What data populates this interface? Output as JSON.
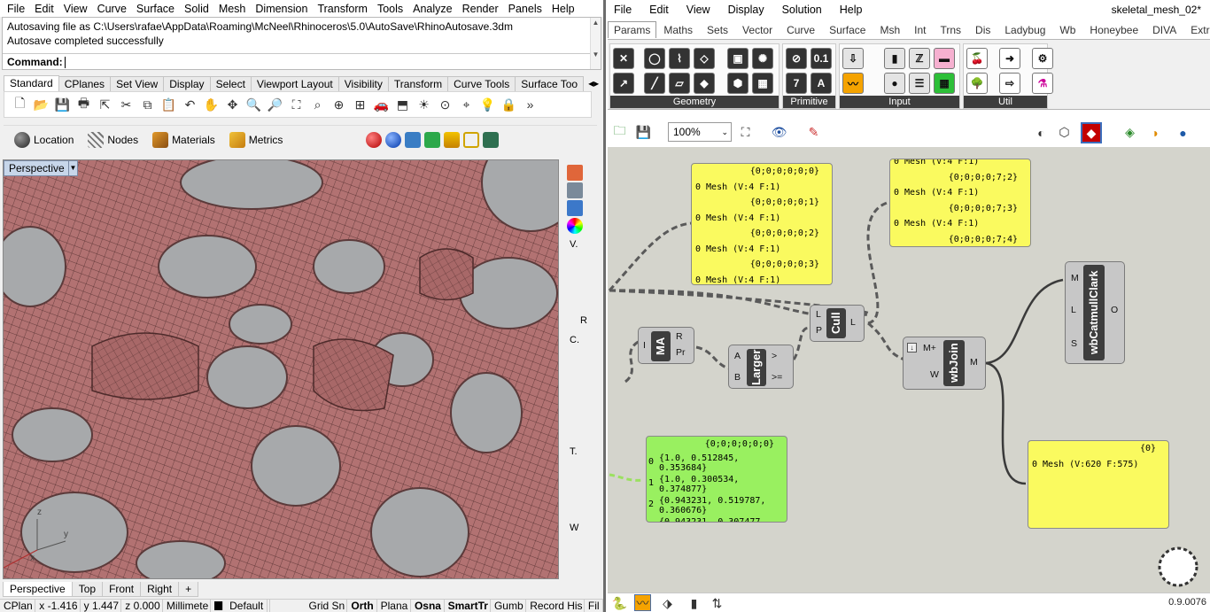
{
  "rhino": {
    "menu": [
      "File",
      "Edit",
      "View",
      "Curve",
      "Surface",
      "Solid",
      "Mesh",
      "Dimension",
      "Transform",
      "Tools",
      "Analyze",
      "Render",
      "Panels",
      "Help"
    ],
    "command_history": [
      "Autosaving file as C:\\Users\\rafae\\AppData\\Roaming\\McNeel\\Rhinoceros\\5.0\\AutoSave\\RhinoAutosave.3dm",
      "Autosave completed successfully"
    ],
    "command_label": "Command:",
    "toolbar_tabs": [
      "Standard",
      "CPlanes",
      "Set View",
      "Display",
      "Select",
      "Viewport Layout",
      "Visibility",
      "Transform",
      "Curve Tools",
      "Surface Too"
    ],
    "active_tab": "Standard",
    "toolbar2": [
      "Location",
      "Nodes",
      "Materials",
      "Metrics"
    ],
    "viewport_title": "Perspective",
    "viewport_tabs": [
      "Perspective",
      "Top",
      "Front",
      "Right"
    ],
    "side_panel_labels": [
      "V.",
      "R",
      "C.",
      "T.",
      "W"
    ],
    "status": {
      "cplane": "CPlan",
      "x": "x -1.416",
      "y": "y 1.447",
      "z": "z 0.000",
      "units": "Millimete",
      "layer": "Default",
      "grid_snap": "Grid Sn",
      "ortho": "Orth",
      "planar": "Plana",
      "osnap": "Osna",
      "smarttrack": "SmartTr",
      "gumball": "Gumb",
      "record_history": "Record His",
      "filter": "Fil"
    },
    "mesh_color": "#b06e6e",
    "viewport_bg": "#a7a9ab"
  },
  "gh": {
    "menu": [
      "File",
      "Edit",
      "View",
      "Display",
      "Solution",
      "Help"
    ],
    "title": "skeletal_mesh_02*",
    "tabs": [
      "Params",
      "Maths",
      "Sets",
      "Vector",
      "Curve",
      "Surface",
      "Msh",
      "Int",
      "Trns",
      "Dis",
      "Ladybug",
      "Wb",
      "Honeybee",
      "DIVA",
      "Extra"
    ],
    "active_tab": "Params",
    "ribbon_groups": [
      "Geometry",
      "Primitive",
      "Input",
      "Util"
    ],
    "zoom": "100%",
    "version": "0.9.0076",
    "panel_top": {
      "rows": [
        {
          "k": "hdr",
          "t": "{0;0;0;0;0;0}"
        },
        {
          "k": "item",
          "t": "0 Mesh (V:4  F:1)"
        },
        {
          "k": "hdr",
          "t": "{0;0;0;0;0;1}"
        },
        {
          "k": "item",
          "t": "0 Mesh (V:4  F:1)"
        },
        {
          "k": "hdr",
          "t": "{0;0;0;0;0;2}"
        },
        {
          "k": "item",
          "t": "0 Mesh (V:4  F:1)"
        },
        {
          "k": "hdr",
          "t": "{0;0;0;0;0;3}"
        },
        {
          "k": "item",
          "t": "0 Mesh (V:4  F:1)"
        }
      ]
    },
    "panel_right": {
      "rows": [
        {
          "k": "item",
          "t": "0 Mesh (V:4  F:1)"
        },
        {
          "k": "hdr",
          "t": "{0;0;0;0;7;2}"
        },
        {
          "k": "item",
          "t": "0 Mesh (V:4  F:1)"
        },
        {
          "k": "hdr",
          "t": "{0;0;0;0;7;3}"
        },
        {
          "k": "item",
          "t": "0 Mesh (V:4  F:1)"
        },
        {
          "k": "hdr",
          "t": "{0;0;0;0;7;4}"
        }
      ]
    },
    "panel_green": {
      "header": "{0;0;0;0;0;0}",
      "items": [
        {
          "i": "0",
          "t": "{1.0, 0.512845, 0.353684}"
        },
        {
          "i": "1",
          "t": "{1.0, 0.300534, 0.374877}"
        },
        {
          "i": "2",
          "t": "{0.943231, 0.519787, 0.360676}"
        },
        {
          "i": "",
          "t": "{0.943231, 0.307477"
        }
      ]
    },
    "panel_result": {
      "header": "{0}",
      "item": "0 Mesh (V:620  F:575)"
    },
    "comp_ma": {
      "name": "MA",
      "in": "I",
      "out1": "R",
      "out2": "Pr"
    },
    "comp_larger": {
      "name": "Larger",
      "in1": "A",
      "in2": "B",
      "out1": ">",
      "out2": ">="
    },
    "comp_cull": {
      "name": "Cull",
      "in1": "L",
      "in2": "P",
      "out": "L"
    },
    "comp_wbjoin": {
      "name": "wbJoin",
      "in1": "M+",
      "in2": "W",
      "out": "M"
    },
    "comp_catmull": {
      "name": "wbCatmullClark",
      "in1": "M",
      "in2": "L",
      "in3": "S",
      "out": "O"
    },
    "canvas_bg": "#d4d4cc"
  }
}
